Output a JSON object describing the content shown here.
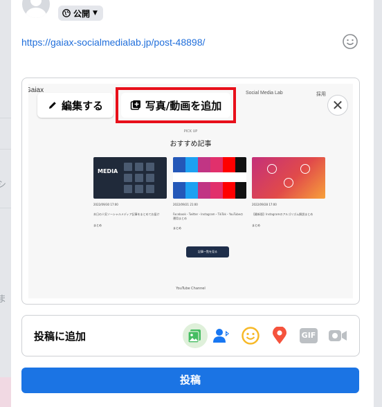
{
  "composer": {
    "privacy_label": "公開",
    "link_text": "https://gaiax-socialmedialab.jp/post-48898/"
  },
  "preview": {
    "edit_label": "編集する",
    "add_media_label": "写真/動画を追加",
    "site": {
      "logo": "Gaiax",
      "site_name": "Social Media Lab",
      "corner_text": "採用",
      "pick_up": "PICK UP",
      "heading": "おすすめ記事",
      "cards": [
        {
          "date": "2022/09/30 17:00",
          "title": "本日の人気ソーシャルメディア記事をまとめてお届け",
          "tag": "まとめ",
          "badge": "MEDIA"
        },
        {
          "date": "2022/09/21 21:00",
          "title": "Facebook・Twitter・Instagram・TikTok・YouTubeの運用まとめ",
          "tag": "まとめ"
        },
        {
          "date": "2022/09/28 17:00",
          "title": "【最新版】Instagramのアルゴリズム解説まとめ",
          "tag": "まとめ"
        }
      ],
      "more_label": "記事一覧を見る",
      "youtube": "YouTube Channel"
    }
  },
  "add_to_post": {
    "label": "投稿に追加",
    "icons": [
      "photo-video-icon",
      "tag-people-icon",
      "feeling-icon",
      "check-in-icon",
      "gif-icon",
      "live-video-icon"
    ],
    "gif_text": "GIF"
  },
  "post_button_label": "投稿",
  "background": {
    "fragment_1": "シ",
    "fragment_2": "ま"
  },
  "colors": {
    "accent": "#1b74e4",
    "link": "#216fdb",
    "highlight": "#e8101a"
  }
}
